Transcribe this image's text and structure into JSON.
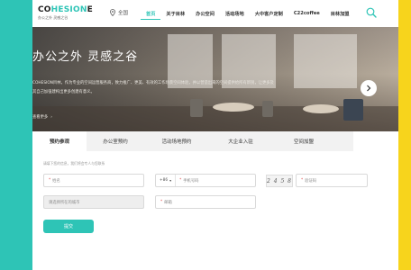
{
  "brand": {
    "logo_prefix": "CO",
    "logo_accent": "HESION",
    "logo_suffix": "E",
    "logo_sub": "办公之外 灵感之谷"
  },
  "header": {
    "location": "全国",
    "nav": [
      "首页",
      "关于目林",
      "办公空间",
      "活动场地",
      "大中客户定制",
      "C22coffee",
      "目林加盟"
    ],
    "active_nav": 0
  },
  "hero": {
    "title": "办公之外 灵感之谷",
    "description": "COHESION目林，作为专业的空间运营服务商，致力推广、更美、有效的工作场景空间体验，并以营造出来的空间提供给所有新锐，让更多及其自己加强建构出更多创建有意义。",
    "more_label": "查看更多"
  },
  "tabs": [
    "预约参观",
    "办公室预约",
    "活动场地预约",
    "大企业入驻",
    "空间加盟"
  ],
  "active_tab": 0,
  "form": {
    "hint": "请填下您的信息，我们将会专人与您联系",
    "name_placeholder": "姓名",
    "country_code": "+86",
    "phone_placeholder": "手机号码",
    "captcha_text": "2 4 5 8",
    "captcha_placeholder": "验证码",
    "city_placeholder": "请选择所在的城市",
    "email_placeholder": "邮箱",
    "submit_label": "提交"
  },
  "colors": {
    "accent": "#2ec4b6",
    "left_bar": "#2ec4b6",
    "right_bar": "#f7d41c"
  }
}
